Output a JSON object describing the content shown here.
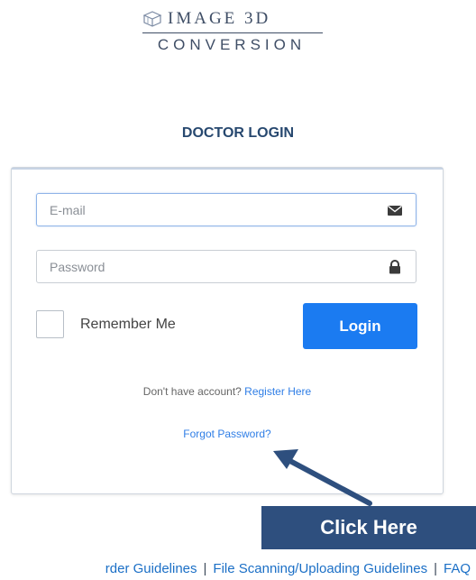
{
  "brand": {
    "line1": "IMAGE 3D",
    "line2": "CONVERSION",
    "icon": "stacked-boxes-icon"
  },
  "page_title": "DOCTOR LOGIN",
  "form": {
    "email": {
      "value": "",
      "placeholder": "E-mail",
      "icon": "envelope-icon"
    },
    "password": {
      "value": "",
      "placeholder": "Password",
      "icon": "lock-icon"
    },
    "remember_label": "Remember Me",
    "remember_checked": false,
    "login_label": "Login",
    "register_prompt": "Don't have account?",
    "register_link": "Register Here",
    "forgot_link": "Forgot Password?"
  },
  "callout": {
    "label": "Click Here",
    "color": "#2e4f7e"
  },
  "footer": {
    "links": [
      "rder Guidelines",
      "File Scanning/Uploading Guidelines",
      "FAQ"
    ],
    "separator": "|"
  },
  "colors": {
    "primary_button": "#1b7bf1",
    "link": "#2f7ee6",
    "title": "#27486f",
    "arrow": "#2e4f7e"
  }
}
